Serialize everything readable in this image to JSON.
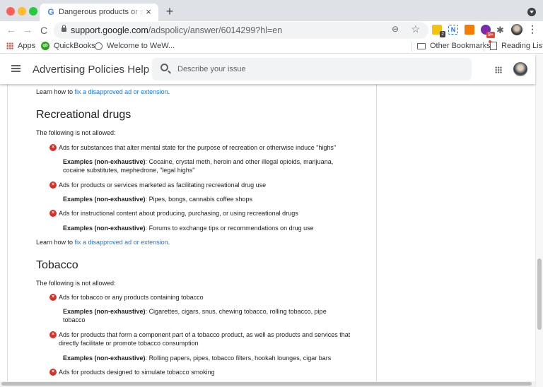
{
  "browser": {
    "tab": {
      "title": "Dangerous products or services",
      "favicon": "G",
      "close": "×"
    },
    "new_tab": "+",
    "nav": {
      "back": "←",
      "forward": "→",
      "reload": "C"
    },
    "url": {
      "host": "support.google.com",
      "path": "/adspolicy/answer/6014299?hl=en"
    },
    "zoom_icon": "⊖",
    "star_icon": "☆",
    "extensions": [
      {
        "name": "extension-yellow",
        "badge": "2"
      },
      {
        "name": "extension-n",
        "label": "N"
      },
      {
        "name": "extension-orange"
      },
      {
        "name": "extension-purple",
        "badge": "9+"
      }
    ],
    "puzzle_icon": "✱",
    "kebab": "⋮",
    "bookmarks": [
      {
        "label": "Apps"
      },
      {
        "label": "QuickBooks",
        "icon_text": "qb"
      },
      {
        "label": "Welcome to WeW..."
      }
    ],
    "other_bookmarks": "Other Bookmarks",
    "reading_list": "Reading List"
  },
  "header": {
    "title": "Advertising Policies Help",
    "search_placeholder": "Describe your issue"
  },
  "article": {
    "learn_prefix": "Learn how to ",
    "learn_link": "fix a disapproved ad or extension",
    "learn_suffix": ".",
    "example_label": "Examples (non-exhaustive)",
    "example_sep": ": ",
    "x_glyph": "×",
    "sections": [
      {
        "heading": "Recreational drugs",
        "intro": "The following is not allowed:",
        "items": [
          {
            "text": "Ads for substances that alter mental state for the purpose of recreation or otherwise induce \"highs\"",
            "examples": "Cocaine, crystal meth, heroin and other illegal opioids, marijuana, cocaine substitutes, mephedrone, \"legal highs\""
          },
          {
            "text": "Ads for products or services marketed as facilitating recreational drug use",
            "examples": "Pipes, bongs, cannabis coffee shops"
          },
          {
            "text": "Ads for instructional content about producing, purchasing, or using recreational drugs",
            "examples": "Forums to exchange tips or recommendations on drug use"
          }
        ]
      },
      {
        "heading": "Tobacco",
        "intro": "The following is not allowed:",
        "items": [
          {
            "text": "Ads for tobacco or any products containing tobacco",
            "examples": "Cigarettes, cigars, snus, chewing tobacco, rolling tobacco, pipe tobacco"
          },
          {
            "text": "Ads for products that form a component part of a tobacco product, as well as products and services that directly facilitate or promote tobacco consumption",
            "examples": "Rolling papers, pipes, tobacco filters, hookah lounges, cigar bars"
          },
          {
            "text": "Ads for products designed to simulate tobacco smoking"
          }
        ]
      }
    ]
  }
}
